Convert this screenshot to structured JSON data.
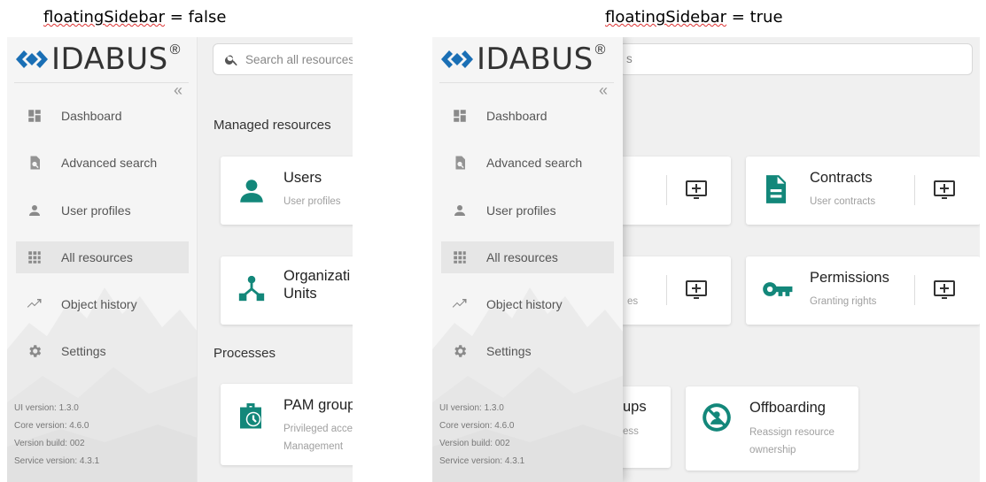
{
  "captions": {
    "left": {
      "key": "floatingSidebar",
      "rest": " = false"
    },
    "right": {
      "key": "floatingSidebar",
      "rest": " = true"
    }
  },
  "colors": {
    "accent": "#13877a",
    "logo_blue": "#1a6fb5",
    "sidebar_bg": "#f5f5f5",
    "content_bg": "#f0f0f0"
  },
  "brand": {
    "name": "IDABUS",
    "reg": "®"
  },
  "sidebar": {
    "collapse_icon": "«",
    "items": [
      {
        "label": "Dashboard",
        "icon": "dashboard-icon"
      },
      {
        "label": "Advanced search",
        "icon": "advanced-search-icon"
      },
      {
        "label": "User profiles",
        "icon": "person-icon"
      },
      {
        "label": "All resources",
        "icon": "grid-icon",
        "active": true
      },
      {
        "label": "Object history",
        "icon": "trending-icon"
      },
      {
        "label": "Settings",
        "icon": "gear-icon"
      }
    ],
    "versions": {
      "ui": "UI version: 1.3.0",
      "core": "Core version: 4.6.0",
      "build": "Version build: 002",
      "service": "Service version: 4.3.1"
    }
  },
  "search": {
    "placeholder": "Search all resources",
    "right_tail": "s"
  },
  "sections": {
    "managed": "Managed resources",
    "processes": "Processes"
  },
  "left_cards": {
    "users": {
      "title": "Users",
      "sub": "User profiles"
    },
    "org": {
      "title1": "Organizati",
      "title2": "Units"
    },
    "pam": {
      "title": "PAM group",
      "sub1": "Privileged acce",
      "sub2": "Management"
    }
  },
  "right_cards": {
    "contracts": {
      "title": "Contracts",
      "sub": "User contracts"
    },
    "permissions": {
      "title": "Permissions",
      "sub": "Granting rights"
    },
    "partial_es": "es",
    "partial_ups": "ups",
    "partial_ess": "ess",
    "offboarding": {
      "title": "Offboarding",
      "sub1": "Reassign resource",
      "sub2": "ownership"
    }
  }
}
